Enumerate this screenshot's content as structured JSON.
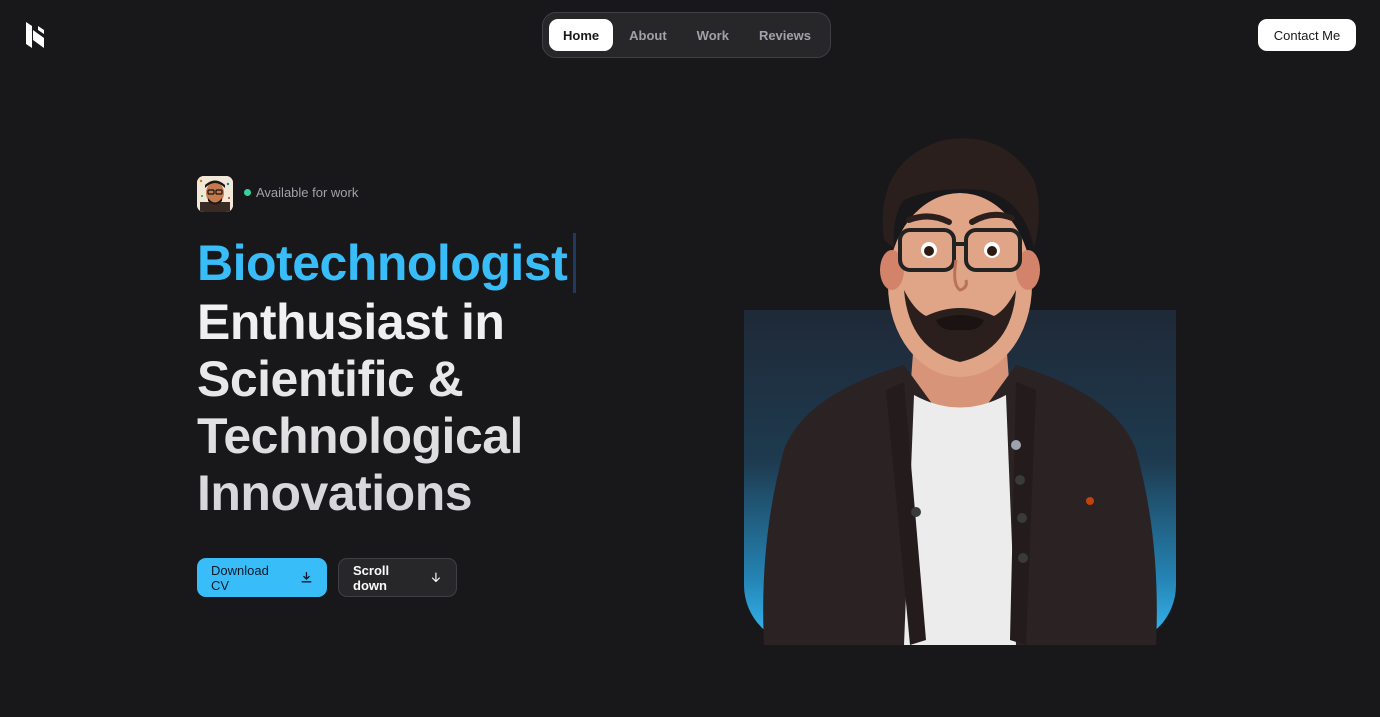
{
  "header": {
    "logo_icon": "brand-logo-icon",
    "nav": [
      {
        "label": "Home",
        "active": true
      },
      {
        "label": "About",
        "active": false
      },
      {
        "label": "Work",
        "active": false
      },
      {
        "label": "Reviews",
        "active": false
      }
    ],
    "contact_label": "Contact Me"
  },
  "hero": {
    "status": "Available for work",
    "role": "Biotechnologist",
    "tagline": "Enthusiast in Scientific & Technological Innovations",
    "download_label": "Download CV",
    "scroll_label": "Scroll down"
  },
  "colors": {
    "background": "#18181b",
    "accent": "#38bdf8",
    "status": "#34d399"
  }
}
